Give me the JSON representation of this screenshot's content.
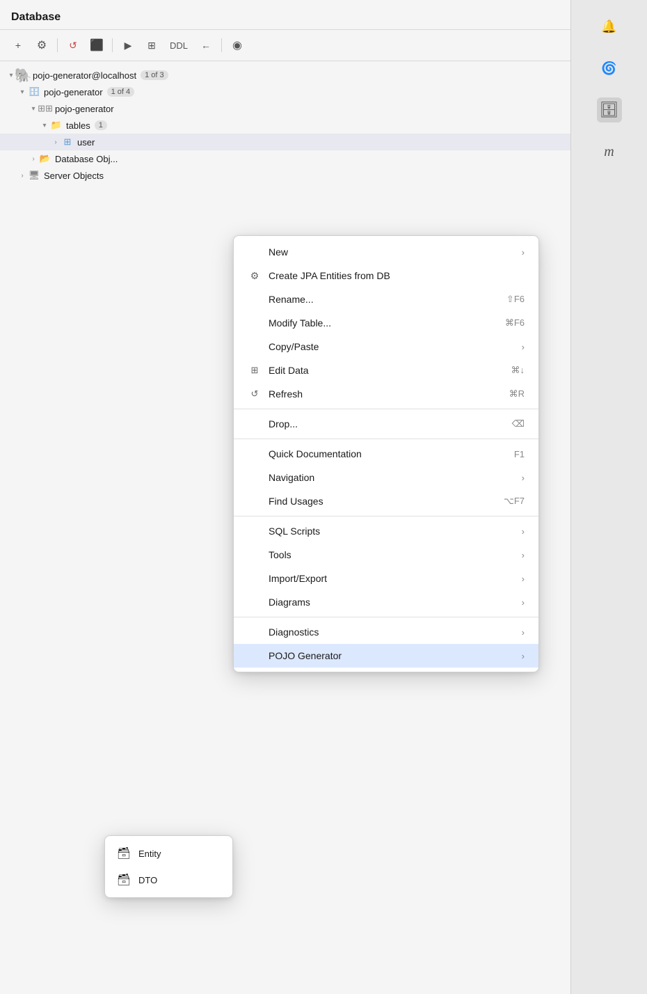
{
  "header": {
    "title": "Database"
  },
  "toolbar": {
    "buttons": [
      {
        "name": "add",
        "icon": "+"
      },
      {
        "name": "db-settings",
        "icon": "⚙"
      },
      {
        "name": "refresh",
        "icon": "↺"
      },
      {
        "name": "stop",
        "icon": "⬛"
      },
      {
        "name": "run",
        "icon": "▶"
      },
      {
        "name": "grid",
        "icon": "⊞"
      },
      {
        "name": "ddl",
        "text": "DDL"
      },
      {
        "name": "jump",
        "icon": "←"
      },
      {
        "name": "eye",
        "icon": "◉"
      }
    ]
  },
  "tree": {
    "items": [
      {
        "id": "root",
        "label": "pojo-generator@localhost",
        "badge": "1 of 3",
        "level": 0,
        "arrow": "open",
        "icon": "pg"
      },
      {
        "id": "db",
        "label": "pojo-generator",
        "badge": "1 of 4",
        "level": 1,
        "arrow": "open",
        "icon": "db"
      },
      {
        "id": "schema",
        "label": "pojo-generator",
        "badge": "",
        "level": 2,
        "arrow": "open",
        "icon": "schema"
      },
      {
        "id": "tables",
        "label": "tables",
        "badge": "1",
        "level": 3,
        "arrow": "open",
        "icon": "folder"
      },
      {
        "id": "user",
        "label": "user",
        "badge": "",
        "level": 4,
        "arrow": "closed",
        "icon": "table",
        "selected": true
      },
      {
        "id": "dbobj",
        "label": "Database Obj...",
        "badge": "",
        "level": 2,
        "arrow": "closed",
        "icon": "dbobj"
      },
      {
        "id": "servobj",
        "label": "Server Objects",
        "badge": "",
        "level": 1,
        "arrow": "closed",
        "icon": "servobj"
      }
    ]
  },
  "context_menu": {
    "items": [
      {
        "id": "new",
        "label": "New",
        "icon": "",
        "shortcut": "",
        "arrow": true,
        "separator_after": false
      },
      {
        "id": "create-jpa",
        "label": "Create JPA Entities from DB",
        "icon": "db",
        "shortcut": "",
        "arrow": false,
        "separator_after": false
      },
      {
        "id": "rename",
        "label": "Rename...",
        "icon": "",
        "shortcut": "⇧F6",
        "arrow": false,
        "separator_after": false
      },
      {
        "id": "modify",
        "label": "Modify Table...",
        "icon": "",
        "shortcut": "⌘F6",
        "arrow": false,
        "separator_after": false
      },
      {
        "id": "copy-paste",
        "label": "Copy/Paste",
        "icon": "",
        "shortcut": "",
        "arrow": true,
        "separator_after": false
      },
      {
        "id": "edit-data",
        "label": "Edit Data",
        "icon": "table",
        "shortcut": "⌘↓",
        "arrow": false,
        "separator_after": false
      },
      {
        "id": "refresh",
        "label": "Refresh",
        "icon": "refresh",
        "shortcut": "⌘R",
        "arrow": false,
        "separator_after": true
      },
      {
        "id": "drop",
        "label": "Drop...",
        "icon": "",
        "shortcut": "⌫",
        "arrow": false,
        "separator_after": true
      },
      {
        "id": "quick-doc",
        "label": "Quick Documentation",
        "icon": "",
        "shortcut": "F1",
        "arrow": false,
        "separator_after": false
      },
      {
        "id": "navigation",
        "label": "Navigation",
        "icon": "",
        "shortcut": "",
        "arrow": true,
        "separator_after": false
      },
      {
        "id": "find-usages",
        "label": "Find Usages",
        "icon": "",
        "shortcut": "⌥F7",
        "arrow": false,
        "separator_after": true
      },
      {
        "id": "sql-scripts",
        "label": "SQL Scripts",
        "icon": "",
        "shortcut": "",
        "arrow": true,
        "separator_after": false
      },
      {
        "id": "tools",
        "label": "Tools",
        "icon": "",
        "shortcut": "",
        "arrow": true,
        "separator_after": false
      },
      {
        "id": "import-export",
        "label": "Import/Export",
        "icon": "",
        "shortcut": "",
        "arrow": true,
        "separator_after": false
      },
      {
        "id": "diagrams",
        "label": "Diagrams",
        "icon": "",
        "shortcut": "",
        "arrow": true,
        "separator_after": true
      },
      {
        "id": "diagnostics",
        "label": "Diagnostics",
        "icon": "",
        "shortcut": "",
        "arrow": true,
        "separator_after": false
      },
      {
        "id": "pojo-gen",
        "label": "POJO Generator",
        "icon": "",
        "shortcut": "",
        "arrow": true,
        "active": true,
        "separator_after": false
      }
    ]
  },
  "sub_menu": {
    "items": [
      {
        "id": "entity",
        "label": "Entity",
        "icon": "🗃"
      },
      {
        "id": "dto",
        "label": "DTO",
        "icon": "🗃"
      }
    ]
  },
  "sidebar": {
    "icons": [
      {
        "name": "bell-icon",
        "icon": "🔔"
      },
      {
        "name": "spiral-icon",
        "icon": "🌀"
      },
      {
        "name": "database-icon",
        "icon": "🗄",
        "active": true
      },
      {
        "name": "m-icon",
        "text": "m"
      }
    ]
  }
}
